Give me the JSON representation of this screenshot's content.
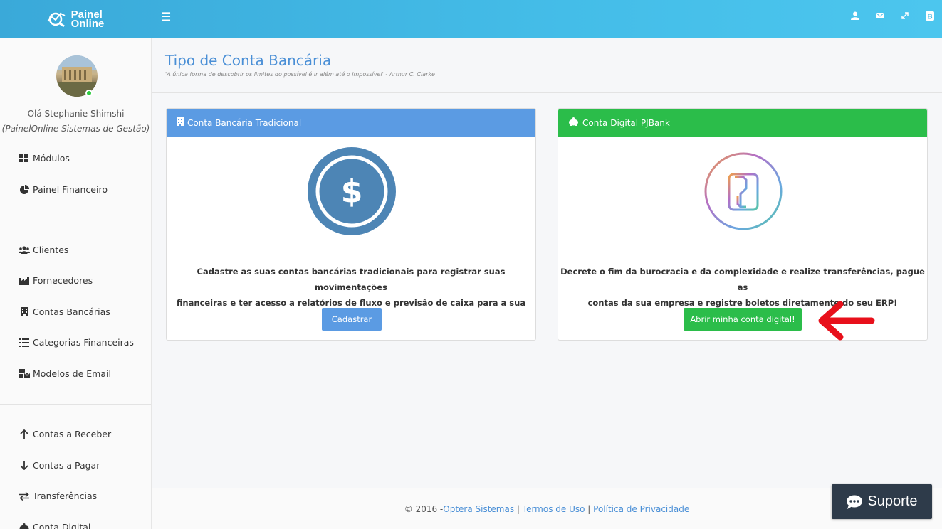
{
  "brand": {
    "line1": "Painel",
    "line2": "Online"
  },
  "topbar": {
    "icons": [
      "user-icon",
      "envelope-icon",
      "expand-icon",
      "bootstrap-icon"
    ]
  },
  "sidebar": {
    "greeting": "Olá Stephanie Shimshi",
    "company": "(PainelOnline Sistemas de Gestão)",
    "items": [
      {
        "label": "Módulos",
        "icon": "grid-icon"
      },
      {
        "label": "Painel Financeiro",
        "icon": "pie-chart-icon"
      },
      {
        "label": "Clientes",
        "icon": "users-icon"
      },
      {
        "label": "Fornecedores",
        "icon": "industry-icon"
      },
      {
        "label": "Contas Bancárias",
        "icon": "building-icon"
      },
      {
        "label": "Categorias Financeiras",
        "icon": "list-icon"
      },
      {
        "label": "Modelos de Email",
        "icon": "mail-bulk-icon"
      },
      {
        "label": "Contas a Receber",
        "icon": "arrow-up-icon"
      },
      {
        "label": "Contas a Pagar",
        "icon": "arrow-down-icon"
      },
      {
        "label": "Transferências",
        "icon": "exchange-icon"
      },
      {
        "label": "Conta Digital",
        "icon": "piggy-bank-icon"
      }
    ]
  },
  "main": {
    "title": "Tipo de Conta Bancária",
    "quote": "'A única forma de descobrir os limites do possível é ir além até o impossível' - Arthur C. Clarke",
    "cards": [
      {
        "header": "Conta Bancária Tradicional",
        "header_color": "#5b9be3",
        "text_line1": "Cadastre as suas contas bancárias tradicionais para registrar suas movimentações",
        "text_line2": "financeiras e ter acesso a relatórios de fluxo e previsão de caixa para a sua empresa.",
        "button": "Cadastrar",
        "button_color": "#5b9be3",
        "image_symbol": "$"
      },
      {
        "header": "Conta Digital PJBank",
        "header_color": "#2bbd4a",
        "text_line1": "Decrete o fim da burocracia e da complexidade e realize transferências, pague as",
        "text_line2": "contas da sua empresa e registre boletos diretamente do seu ERP!",
        "button": "Abrir minha conta digital!",
        "button_color": "#2bbd4a"
      }
    ]
  },
  "footer": {
    "copyright": "© 2016 - ",
    "company_link": "Optera Sistemas",
    "sep1": " | ",
    "terms_link": "Termos de Uso",
    "sep2": " | ",
    "privacy_link": "Política de Privacidade"
  },
  "support": {
    "label": "Suporte"
  },
  "colors": {
    "topbar": "#44bde8",
    "accent_blue": "#4a8fd6",
    "green": "#2bbd4a",
    "arrow": "#e8101b",
    "support_bg": "#2e3b4a"
  }
}
